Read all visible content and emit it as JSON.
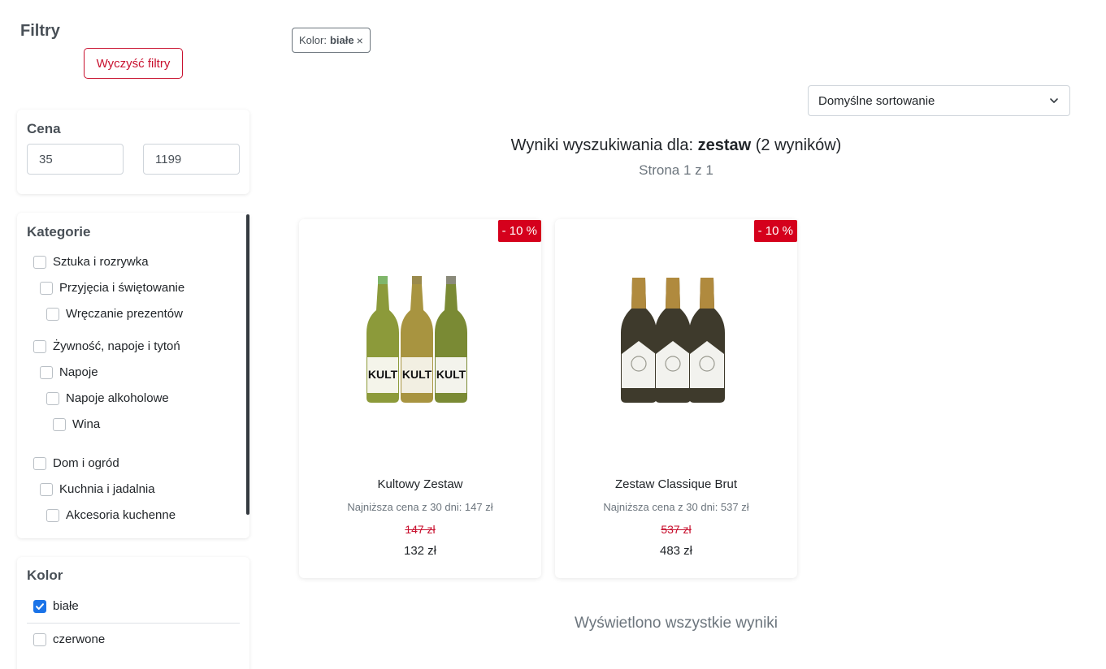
{
  "filters": {
    "title": "Filtry",
    "clear_label": "Wyczyść filtry"
  },
  "price": {
    "title": "Cena",
    "min": "35",
    "max": "1199"
  },
  "categories": {
    "title": "Kategorie",
    "items": [
      {
        "label": "Sztuka i rozrywka",
        "level": 0
      },
      {
        "label": "Przyjęcia i świętowanie",
        "level": 1
      },
      {
        "label": "Wręczanie prezentów",
        "level": 2
      },
      {
        "label": "Żywność, napoje i tytoń",
        "level": 0
      },
      {
        "label": "Napoje",
        "level": 1
      },
      {
        "label": "Napoje alkoholowe",
        "level": 2
      },
      {
        "label": "Wina",
        "level": 3
      },
      {
        "label": "Dom i ogród",
        "level": 0
      },
      {
        "label": "Kuchnia i jadalnia",
        "level": 1
      },
      {
        "label": "Akcesoria kuchenne",
        "level": 2
      }
    ]
  },
  "color": {
    "title": "Kolor",
    "options": [
      {
        "label": "białe",
        "checked": true
      },
      {
        "label": "czerwone",
        "checked": false
      }
    ]
  },
  "active_filter": {
    "label": "Kolor:",
    "value": "białe",
    "close": "×"
  },
  "sort": {
    "selected": "Domyślne sortowanie"
  },
  "results": {
    "prefix": "Wyniki wyszukiwania dla:",
    "query": "zestaw",
    "count": "(2 wyników)",
    "page_info": "Strona 1 z 1"
  },
  "products": [
    {
      "name": "Kultowy Zestaw",
      "discount": "- 10 %",
      "lowest_price": "Najniższa cena z 30 dni: 147 zł",
      "old_price": "147 zł",
      "new_price": "132 zł",
      "label_text": "KULT"
    },
    {
      "name": "Zestaw Classique Brut",
      "discount": "- 10 %",
      "lowest_price": "Najniższa cena z 30 dni: 537 zł",
      "old_price": "537 zł",
      "new_price": "483 zł"
    }
  ],
  "footer_note": "Wyświetlono wszystkie wyniki",
  "colors": {
    "accent": "#c8102e",
    "badge": "#d5001c",
    "checkbox_checked": "#1a73e8"
  }
}
